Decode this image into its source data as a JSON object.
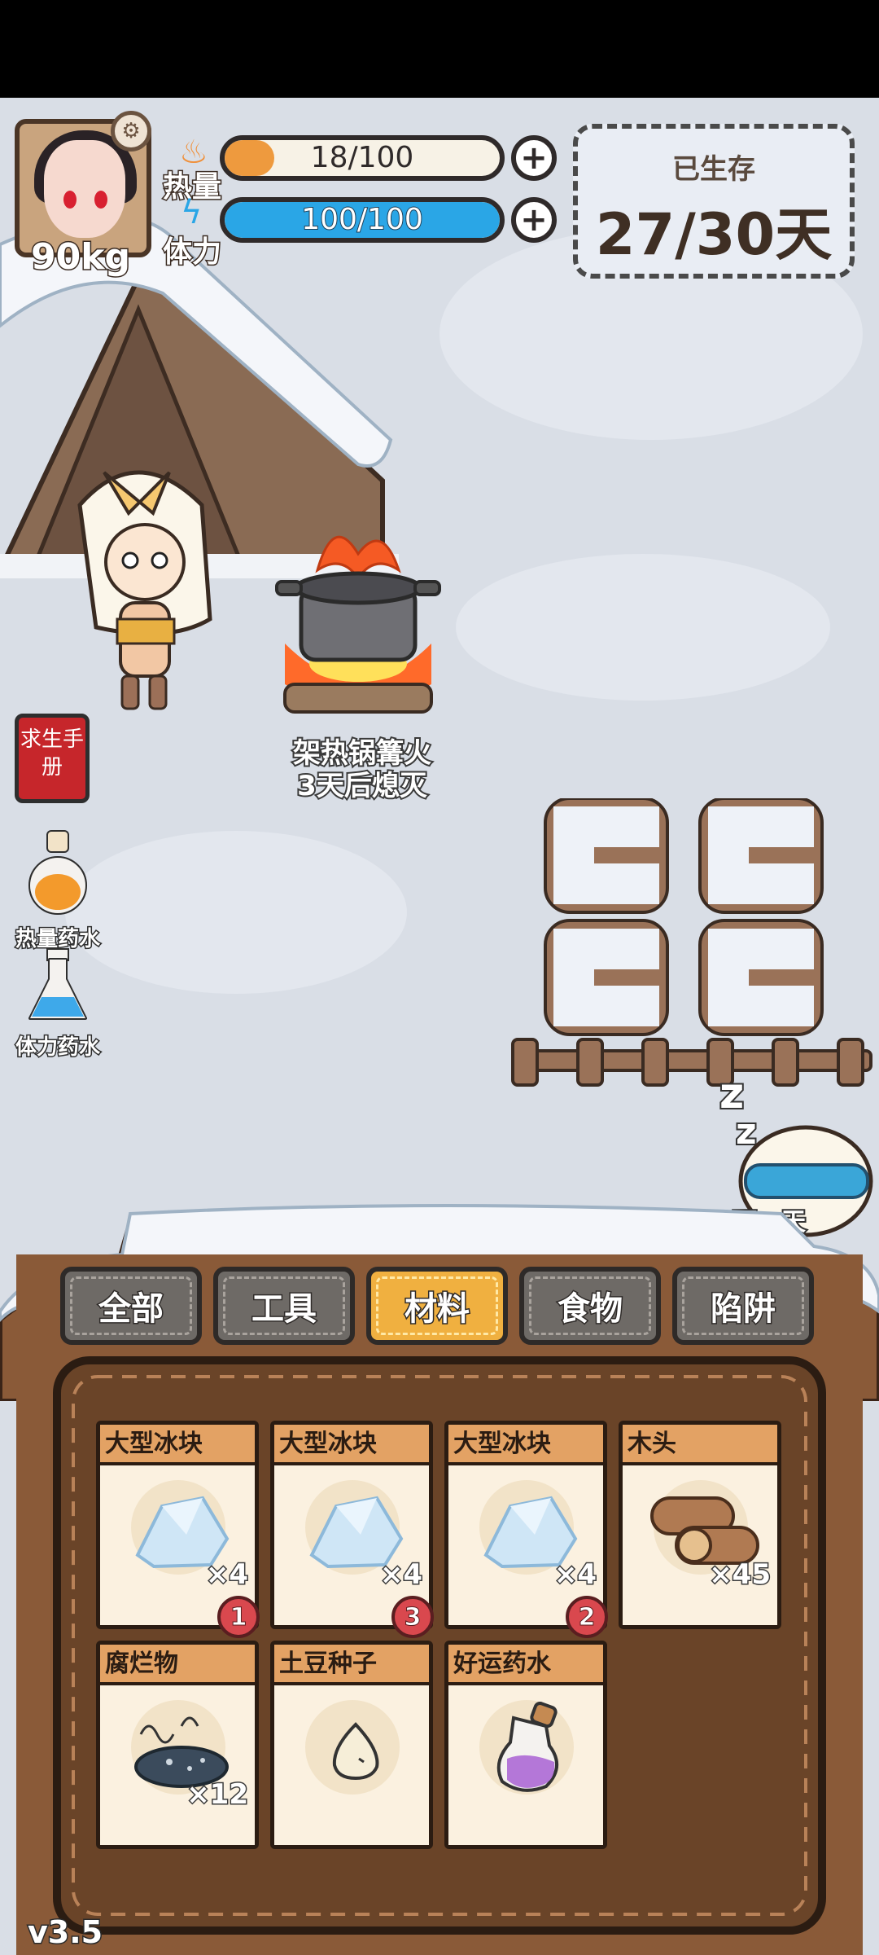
{
  "hud": {
    "weight": "90kg",
    "heat": {
      "label": "热量",
      "value": "18/100",
      "fraction": 0.18
    },
    "stamina": {
      "label": "体力",
      "value": "100/100",
      "fraction": 1.0
    },
    "survived_title": "已生存",
    "survived_days": "27/30天",
    "colors": {
      "heat": "#ee9a3e",
      "stamina": "#2aa6e6"
    }
  },
  "world": {
    "campfire_label_line1": "架热锅篝火",
    "campfire_label_line2": "3天后熄灭",
    "next_day": "下一天"
  },
  "side": {
    "manual": "求生手册",
    "heat_potion": "热量药水",
    "stamina_potion": "体力药水"
  },
  "tabs": [
    {
      "label": "全部",
      "active": false
    },
    {
      "label": "工具",
      "active": false
    },
    {
      "label": "材料",
      "active": true
    },
    {
      "label": "食物",
      "active": false
    },
    {
      "label": "陷阱",
      "active": false
    }
  ],
  "items": [
    {
      "name": "大型冰块",
      "qty": "×4",
      "badge": "1",
      "icon": "ice-block-icon"
    },
    {
      "name": "大型冰块",
      "qty": "×4",
      "badge": "3",
      "icon": "ice-block-icon"
    },
    {
      "name": "大型冰块",
      "qty": "×4",
      "badge": "2",
      "icon": "ice-block-icon"
    },
    {
      "name": "木头",
      "qty": "×45",
      "badge": "",
      "icon": "wood-log-icon"
    },
    {
      "name": "腐烂物",
      "qty": "×12",
      "badge": "",
      "icon": "rotten-food-icon"
    },
    {
      "name": "土豆种子",
      "qty": "",
      "badge": "",
      "icon": "potato-seed-icon"
    },
    {
      "name": "好运药水",
      "qty": "",
      "badge": "",
      "icon": "luck-potion-icon"
    }
  ],
  "version": "v3.5"
}
